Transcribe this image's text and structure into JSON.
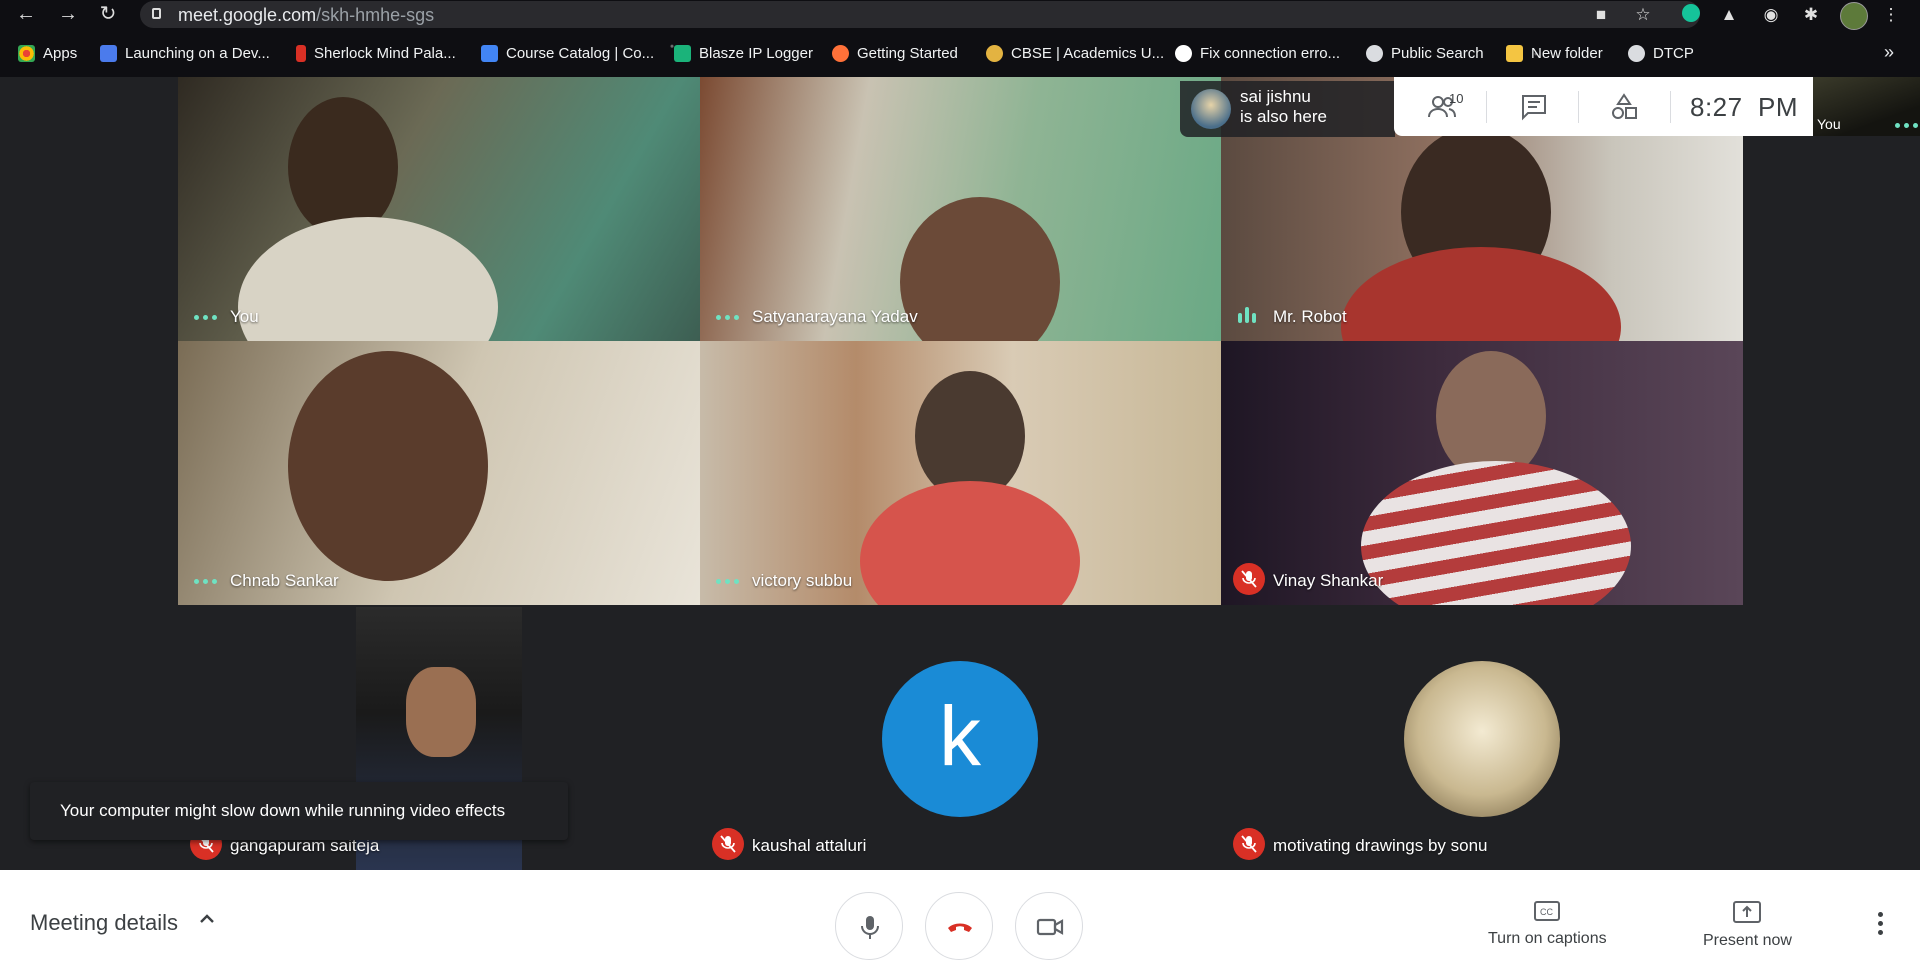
{
  "browser": {
    "url_host": "meet.google.com",
    "url_path": "/skh-hmhe-sgs",
    "bookmarks": [
      {
        "label": "Apps",
        "color": "#ea4335"
      },
      {
        "label": "Launching on a Dev...",
        "color": "#4b7bec"
      },
      {
        "label": "Sherlock Mind Pala...",
        "color": "#d93025"
      },
      {
        "label": "Course Catalog | Co...",
        "color": "#4285f4"
      },
      {
        "label": "Blasze IP Logger",
        "color": "#1bb37a"
      },
      {
        "label": "Getting Started",
        "color": "#ff7139"
      },
      {
        "label": "CBSE | Academics U...",
        "color": "#e3b341"
      },
      {
        "label": "Fix connection erro...",
        "color": "#ffffff"
      },
      {
        "label": "Public Search",
        "color": "#dadce0"
      },
      {
        "label": "New folder",
        "color": "#f4c542"
      },
      {
        "label": "DTCP",
        "color": "#dadce0"
      }
    ],
    "more": "»"
  },
  "meet": {
    "participants": [
      {
        "name": "You",
        "status": "dots"
      },
      {
        "name": "Satyanarayana Yadav",
        "status": "dots"
      },
      {
        "name": "Mr. Robot",
        "status": "speaking"
      },
      {
        "name": "Chnab Sankar",
        "status": "dots"
      },
      {
        "name": "victory subbu",
        "status": "dots"
      },
      {
        "name": "Vinay Shankar",
        "status": "muted"
      },
      {
        "name": "gangapuram saiteja",
        "status": "muted"
      },
      {
        "name": "kaushal attaluri",
        "status": "muted",
        "initial": "k",
        "avatar_color": "#1a8bd6"
      },
      {
        "name": "motivating drawings by sonu",
        "status": "muted"
      }
    ],
    "join_note": {
      "line1": "sai jishnu",
      "line2": "is also here"
    },
    "people_count": "10",
    "clock": "8:27  PM",
    "self_label": "You",
    "toast": "Your computer might slow down while running video effects",
    "bottom": {
      "meeting_details": "Meeting details",
      "captions": "Turn on captions",
      "present": "Present now"
    }
  },
  "icons": [
    "back-icon",
    "forward-icon",
    "reload-icon",
    "lock-icon",
    "camera-blocked-icon",
    "star-icon",
    "grammarly-icon",
    "drive-icon",
    "screenshot-icon",
    "extensions-icon",
    "people-icon",
    "chat-icon",
    "activities-icon",
    "mic-icon",
    "hangup-icon",
    "camera-icon",
    "captions-icon",
    "present-icon",
    "more-icon",
    "mic-off-icon"
  ]
}
